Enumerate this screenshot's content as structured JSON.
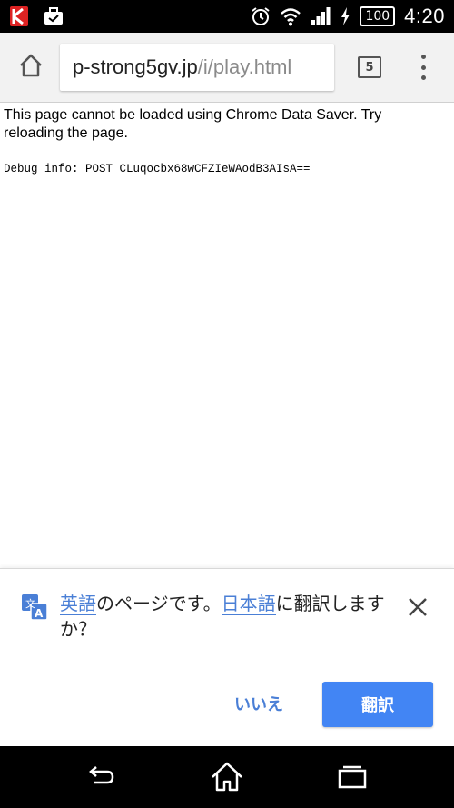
{
  "statusbar": {
    "time": "4:20",
    "battery": "100",
    "icons": [
      "kaspersky-icon",
      "briefcase-icon",
      "alarm-clock-icon",
      "wifi-icon",
      "signal-icon",
      "charging-icon",
      "battery-icon"
    ]
  },
  "toolbar": {
    "url_host": "p-strong5gv.jp",
    "url_path": "/i/play.html",
    "tab_count": "5"
  },
  "page": {
    "error_message": "This page cannot be loaded using Chrome Data Saver. Try reloading the page.",
    "debug_info": "Debug info: POST CLuqocbx68wCFZIeWAodB3AIsA=="
  },
  "translate": {
    "source_lang": "英語",
    "text_part1": "のページです。",
    "target_lang": "日本語",
    "text_part2": "に翻訳しますか？",
    "no_label": "いいえ",
    "translate_label": "翻訳"
  },
  "colors": {
    "accent": "#4285f4",
    "link": "#4a7fd6"
  }
}
